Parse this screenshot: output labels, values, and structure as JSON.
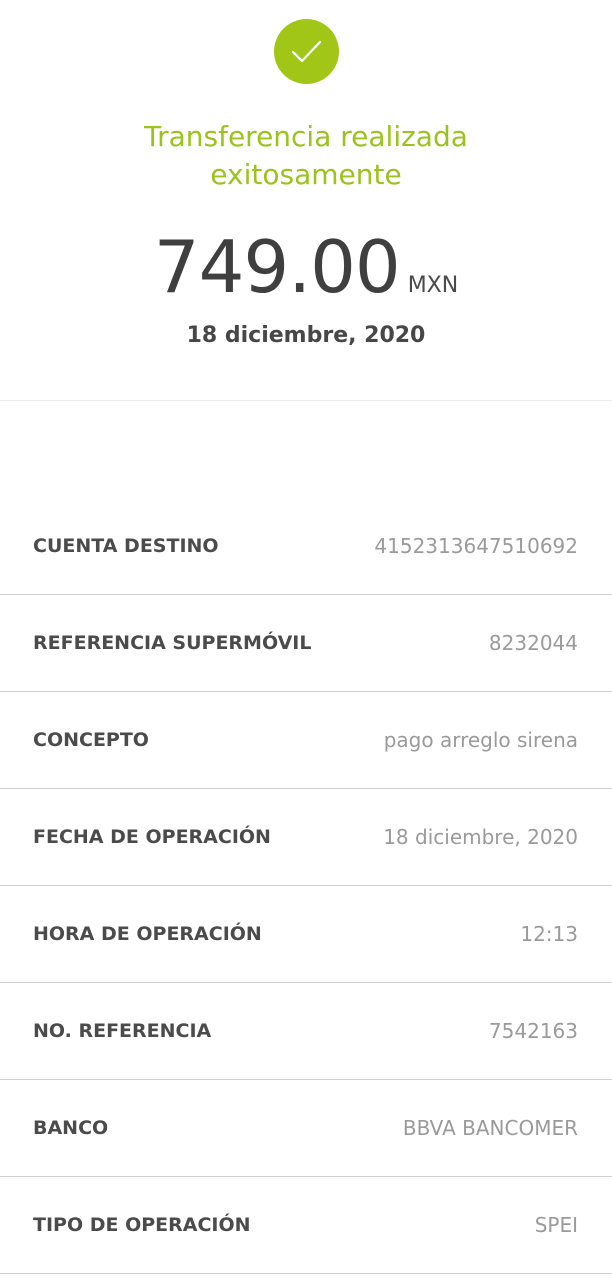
{
  "success": {
    "icon": "checkmark-icon",
    "accent_color": "#a2c617",
    "headline_line1": "Transferencia realizada",
    "headline_line2": "exitosamente"
  },
  "amount": {
    "value": "749.00",
    "currency": "MXN"
  },
  "date": "18 diciembre, 2020",
  "details": {
    "rows": [
      {
        "label": "CUENTA DESTINO",
        "value": "4152313647510692"
      },
      {
        "label": "REFERENCIA SUPERMÓVIL",
        "value": "8232044"
      },
      {
        "label": "CONCEPTO",
        "value": "pago arreglo sirena"
      },
      {
        "label": "FECHA DE OPERACIÓN",
        "value": "18 diciembre, 2020"
      },
      {
        "label": "HORA DE OPERACIÓN",
        "value": "12:13"
      },
      {
        "label": "NO. REFERENCIA",
        "value": "7542163"
      },
      {
        "label": "BANCO",
        "value": "BBVA BANCOMER"
      },
      {
        "label": "TIPO DE OPERACIÓN",
        "value": "SPEI"
      }
    ]
  }
}
